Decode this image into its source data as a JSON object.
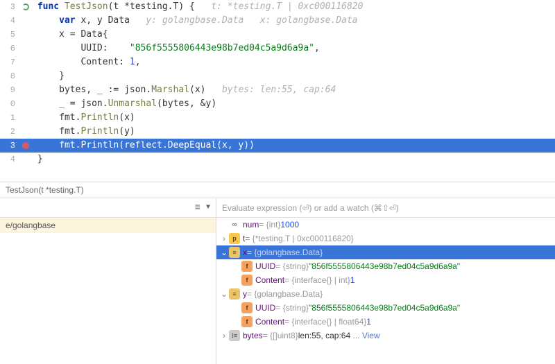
{
  "editor": {
    "lines": [
      {
        "num": "3",
        "icon": "reload"
      },
      {
        "num": "4"
      },
      {
        "num": "5"
      },
      {
        "num": "6"
      },
      {
        "num": "7"
      },
      {
        "num": "8"
      },
      {
        "num": "9"
      },
      {
        "num": "0"
      },
      {
        "num": "1"
      },
      {
        "num": "2"
      },
      {
        "num": "3",
        "icon": "breakpoint",
        "current": true
      },
      {
        "num": "4"
      }
    ],
    "code": {
      "l3_func": "func",
      "l3_name": "TestJson",
      "l3_sig": "(t *testing.T) {",
      "l3_hint": "t: *testing.T | 0xc000116820",
      "l4_var": "var",
      "l4_decl": " x, y ",
      "l4_type": "Data",
      "l4_hint": "y: golangbase.Data   x: golangbase.Data",
      "l5_lhs": "x = ",
      "l5_type": "Data",
      "l5_brace": "{",
      "l6_field": "UUID:    ",
      "l6_val": "\"856f5555806443e98b7ed04c5a9d6a9a\"",
      "l6_comma": ",",
      "l7_field": "Content: ",
      "l7_val": "1",
      "l7_comma": ",",
      "l8_brace": "}",
      "l9_lhs": "bytes, _ := ",
      "l9_pkg": "json",
      "l9_dot": ".",
      "l9_fn": "Marshal",
      "l9_args": "(x)",
      "l9_hint": "bytes: len:55, cap:64",
      "l10_lhs": "_ = ",
      "l10_pkg": "json",
      "l10_dot": ".",
      "l10_fn": "Unmarshal",
      "l10_args": "(bytes, &y)",
      "l11_pkg": "fmt",
      "l11_dot": ".",
      "l11_fn": "Println",
      "l11_args": "(x)",
      "l12_pkg": "fmt",
      "l12_dot": ".",
      "l12_fn": "Println",
      "l12_args": "(y)",
      "l13_pkg": "fmt",
      "l13_dot": ".",
      "l13_fn": "Println",
      "l13_args": "(reflect.DeepEqual(x, y))",
      "l14_brace": "}"
    }
  },
  "breadcrumb": "TestJson(t *testing.T)",
  "frames": {
    "item": "e/golangbase"
  },
  "vars": {
    "placeholder": "Evaluate expression (⏎) or add a watch (⌘⇧⏎)",
    "rows": [
      {
        "name": "num",
        "type": " = {int} ",
        "val": "1000"
      },
      {
        "name": "t",
        "type": " = {*testing.T | 0xc000116820}"
      },
      {
        "name": "x",
        "type": " = {golangbase.Data}"
      },
      {
        "name": "UUID",
        "type": " = {string} ",
        "val": "\"856f5555806443e98b7ed04c5a9d6a9a\""
      },
      {
        "name": "Content",
        "type": " = {interface{} | int} ",
        "val": "1"
      },
      {
        "name": "y",
        "type": " = {golangbase.Data}"
      },
      {
        "name": "UUID",
        "type": " = {string} ",
        "val": "\"856f5555806443e98b7ed04c5a9d6a9a\""
      },
      {
        "name": "Content",
        "type": " = {interface{} | float64} ",
        "val": "1"
      },
      {
        "name": "bytes",
        "type": " = {[]uint8} ",
        "val_pre": "len:55, cap:64",
        "link": "... View"
      }
    ]
  }
}
